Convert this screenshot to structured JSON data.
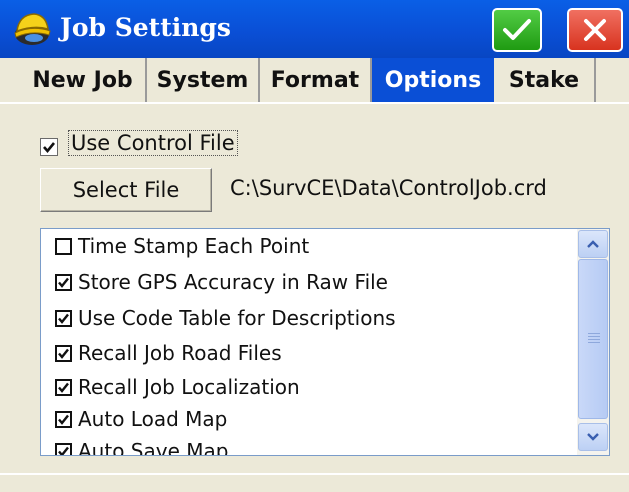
{
  "window": {
    "title": "Job Settings"
  },
  "colors": {
    "titlebar": "#0a4fd6",
    "ok": "#1f9b12",
    "close": "#d8331f",
    "active_tab": "#0a4fd6"
  },
  "icons": {
    "app": "survce-helmet-icon",
    "ok": "checkmark-icon",
    "close": "close-icon"
  },
  "tabs": [
    {
      "label": "New Job"
    },
    {
      "label": "System"
    },
    {
      "label": "Format"
    },
    {
      "label": "Options",
      "active": true
    },
    {
      "label": "Stake"
    }
  ],
  "control_file": {
    "checkbox_label": "Use Control File",
    "checked": true,
    "select_button": "Select File",
    "path": "C:\\SurvCE\\Data\\ControlJob.crd"
  },
  "options": [
    {
      "label": "Time Stamp Each Point",
      "checked": false
    },
    {
      "label": "Store GPS Accuracy in Raw File",
      "checked": true
    },
    {
      "label": "Use Code Table for Descriptions",
      "checked": true
    },
    {
      "label": "Recall Job Road Files",
      "checked": true
    },
    {
      "label": "Recall Job Localization",
      "checked": true
    },
    {
      "label": "Auto Load Map",
      "checked": true
    },
    {
      "label": "Auto Save Map",
      "checked": true
    }
  ]
}
